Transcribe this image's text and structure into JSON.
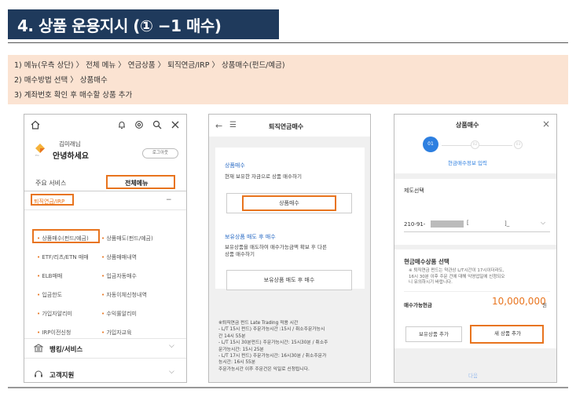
{
  "header": {
    "title": "4. 상품 운용지시 (① −1 매수)"
  },
  "instructions": [
    "1) 메뉴(우측 상단) 〉 전체 메뉴 〉 연금상품 〉 퇴직연금/IRP 〉 상품매수(펀드/예금)",
    "2) 매수방법 선택 〉 상품매수",
    "3) 계좌번호 확인 후  매수할 상품 추가"
  ],
  "panel1": {
    "user_name": "김미래님",
    "greeting": "안녕하세요",
    "logout": "로그아웃",
    "tab_main": "주요 서비스",
    "tab_all": "전체메뉴",
    "section": "퇴직연금/IRP",
    "collapse": "−",
    "items": [
      "상품매수(펀드/예금)",
      "상품매도(펀드/예금)",
      "ETF/리츠/ETN 매매",
      "상품매매내역",
      "ELB매매",
      "입금자동매수",
      "입금한도",
      "자동이체신청내역",
      "가입자알리미",
      "수익률알리미",
      "IRP이전신청",
      "가입자교육"
    ],
    "menu_banking": "뱅킹/서비스",
    "menu_support": "고객지원",
    "chevron": "⌵"
  },
  "panel2": {
    "back": "←",
    "menu": "☰",
    "title": "퇴직연금매수",
    "sec1_title": "상품매수",
    "sec1_desc": "현재 보유한 자금으로 상품 매수하기",
    "btn_buy": "상품매수",
    "sec2_title": "보유상품 매도 후 매수",
    "sec2_desc1": "보유상품을 매도하여 매수가능금액 확보 후 다른",
    "sec2_desc2": "상품 매수하기",
    "btn_sell_buy": "보유상품 매도 후 매수",
    "notes": [
      "※퇴직연금 펀드 Late Trading 적용 시간",
      " - L/T 15시 펀드) 주문가능시간 :15시 / 취소주문가능시",
      "   간 14시 55분",
      " - L/T 15시 30분펀드) 주문가능시간: 15시30분 / 취소주",
      "   문가능시간: 15시 25분",
      " - L/T 17시 펀드) 주문가능시간: 16시30분 / 취소주문가",
      "   능시간: 16시 55분",
      " 주문가능시간 이후 주문건은 익일로 신청됩니다."
    ]
  },
  "panel3": {
    "title": "상품매수",
    "close": "×",
    "step1": "01",
    "step2": "02",
    "step3": "03",
    "step_label": "현금매수정보 입력",
    "sec_system": "제도선택",
    "account": "210-91-",
    "account_suffix": "]_",
    "sec_cash": "현금매수상품 선택",
    "notice1": "※ 퇴직연금 펀드는 약관상 L/T시간이 17시이더라도,",
    "notice2": "16시 30분 이후 주문 건에 대해 익영업일에 신청되오",
    "notice3": "니 유의하시기 바랍니다.",
    "avail_label": "매수가능현금",
    "avail_amount": "10,000,000",
    "avail_unit": "원",
    "btn_add_owned": "보유상품 추가",
    "btn_add_new": "새 상품 추가",
    "next": "다음"
  },
  "colors": {
    "accent": "#e8741e",
    "navy": "#1f3a5c",
    "peach": "#fbe3d2"
  }
}
